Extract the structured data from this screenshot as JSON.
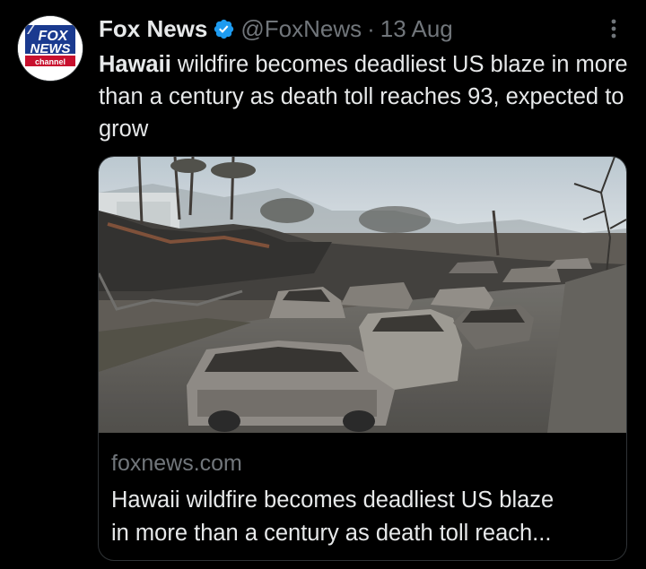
{
  "tweet": {
    "author_name": "Fox News",
    "handle": "@FoxNews",
    "separator": "·",
    "timestamp": "13 Aug",
    "text_bold": "Hawaii",
    "text_rest": " wildfire becomes deadliest US blaze in more than a century as death toll reaches 93, expected to grow",
    "verified_badge_color": "#1d9bf0",
    "more_icon": "more-vertical-icon"
  },
  "avatar": {
    "line1": "FOX",
    "line2": "NEWS",
    "line3": "channel",
    "bg_top": "#1a3a8f",
    "bg_bottom": "#c8102e"
  },
  "card": {
    "domain": "foxnews.com",
    "title_line1": "Hawaii wildfire becomes deadliest US blaze",
    "title_line2": "in more than a century as death toll reach..."
  },
  "colors": {
    "background": "#000000",
    "text_primary": "#e7e9ea",
    "text_secondary": "#71767b",
    "border": "#2f3336"
  }
}
